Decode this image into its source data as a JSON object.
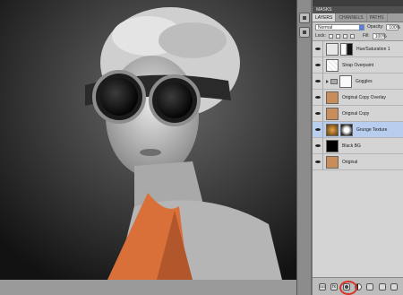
{
  "panel": {
    "masks_label": "MASKS",
    "tabs": [
      {
        "label": "LAYERS",
        "active": true
      },
      {
        "label": "CHANNELS",
        "active": false
      },
      {
        "label": "PATHS",
        "active": false
      }
    ],
    "blend_mode": "Normal",
    "opacity_label": "Opacity:",
    "opacity_value": "100%",
    "fill_label": "Fill:",
    "fill_value": "100%",
    "lock_label": "Lock:"
  },
  "layers": [
    {
      "name": "Hue/Saturation 1",
      "type": "adjustment",
      "selected": false
    },
    {
      "name": "Strap Overpaint",
      "type": "layer",
      "selected": false
    },
    {
      "name": "Goggles",
      "type": "group",
      "selected": false
    },
    {
      "name": "Original Copy Overlay",
      "type": "layer",
      "selected": false
    },
    {
      "name": "Original Copy",
      "type": "layer",
      "selected": false
    },
    {
      "name": "Grunge Texture",
      "type": "layer",
      "selected": true
    },
    {
      "name": "Black BG",
      "type": "layer",
      "selected": false
    },
    {
      "name": "Original",
      "type": "layer",
      "selected": false
    }
  ],
  "footer": {
    "link": "GO",
    "fx": "fx"
  },
  "colors": {
    "selected_layer": "#b9cdee",
    "highlight_ring": "#d7342a",
    "accent_orange": "#d9703a"
  }
}
